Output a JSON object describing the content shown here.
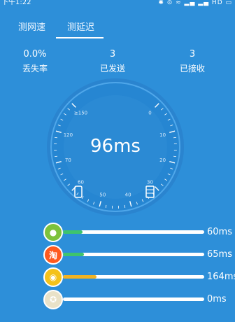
{
  "status_bar": {
    "time": "下午1:22",
    "indicators": "✱ ⊙ ≈ ▂▄ ▂▄ HD ▭"
  },
  "tabs": [
    {
      "label": "测网速"
    },
    {
      "label": "测延迟",
      "active": true
    }
  ],
  "stats": [
    {
      "value": "0.0%",
      "label": "丢失率"
    },
    {
      "value": "3",
      "label": "已发送"
    },
    {
      "value": "3",
      "label": "已接收"
    }
  ],
  "gauge": {
    "reading": "96ms",
    "ticks": [
      "0",
      "10",
      "20",
      "30",
      "40",
      "50",
      "60",
      "70",
      "120",
      "≥150"
    ]
  },
  "apps": [
    {
      "name": "qq-icon",
      "glyph": "●",
      "icon_color": "#7dc23c",
      "ms": "60ms",
      "fill_color": "#3ec46d",
      "progress": 0.14
    },
    {
      "name": "taobao-icon",
      "glyph": "淘",
      "icon_color": "#ff5a1f",
      "ms": "65ms",
      "fill_color": "#3ec46d",
      "progress": 0.15
    },
    {
      "name": "weibo-icon",
      "glyph": "◉",
      "icon_color": "#f4c21b",
      "ms": "164ms",
      "fill_color": "#f0b323",
      "progress": 0.24
    },
    {
      "name": "game-icon",
      "glyph": "✪",
      "icon_color": "#e9e2c8",
      "ms": "0ms",
      "fill_color": "#3ec46d",
      "progress": 0
    }
  ]
}
